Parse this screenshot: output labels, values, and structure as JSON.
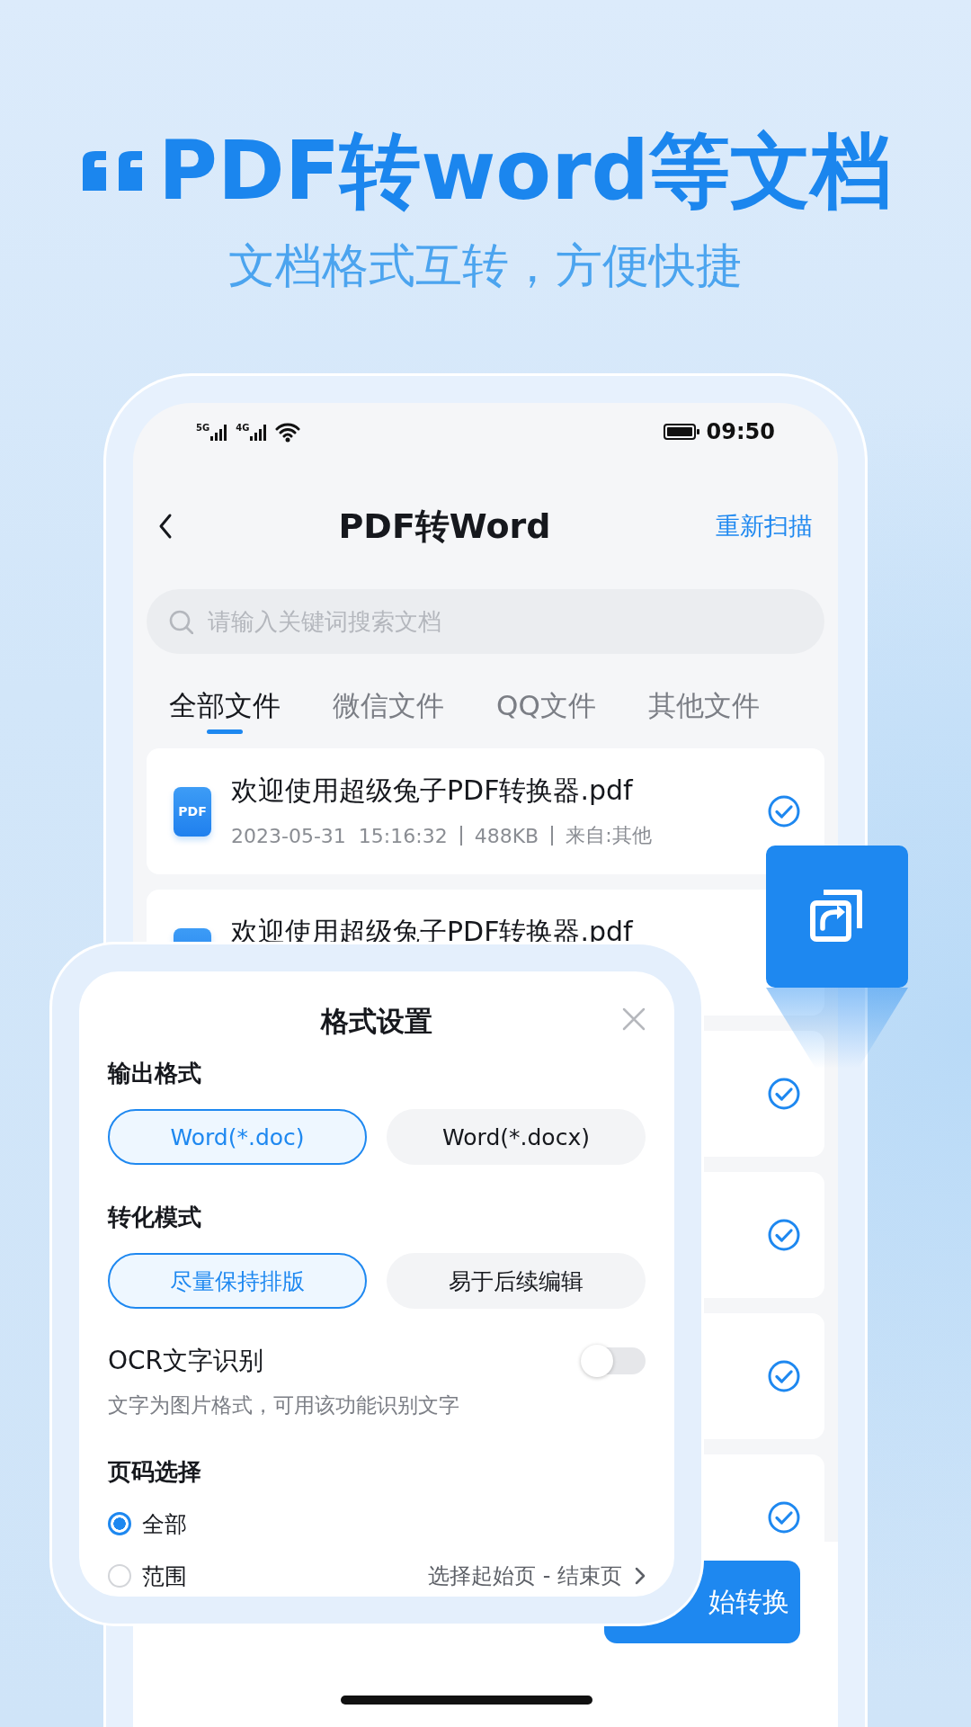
{
  "headline": {
    "title": "PDF转word等文档",
    "subtitle": "文档格式互转，方便快捷"
  },
  "status_bar": {
    "networks": [
      "5G",
      "4G"
    ],
    "time": "09:50"
  },
  "app_bar": {
    "title": "PDF转Word",
    "action": "重新扫描"
  },
  "search": {
    "placeholder": "请输入关键词搜索文档"
  },
  "tabs": [
    {
      "label": "全部文件",
      "selected": true
    },
    {
      "label": "微信文件",
      "selected": false
    },
    {
      "label": "QQ文件",
      "selected": false
    },
    {
      "label": "其他文件",
      "selected": false
    }
  ],
  "files": [
    {
      "name": "欢迎使用超级兔子PDF转换器.pdf",
      "icon_text": "PDF",
      "meta": [
        "2023-05-31  15:16:32",
        "488KB",
        "来自:其他"
      ],
      "checked": true
    },
    {
      "name": "欢迎使用超级兔子PDF转换器.pdf"
    },
    {
      "checked": true
    },
    {
      "checked": true
    },
    {
      "checked": true
    },
    {
      "checked": true
    }
  ],
  "start_button": {
    "label": "始转换"
  },
  "dialog": {
    "title": "格式设置",
    "sections": [
      {
        "kind": "choice",
        "label": "输出格式",
        "options": [
          {
            "label": "Word(*.doc)",
            "selected": true
          },
          {
            "label": "Word(*.docx)",
            "selected": false
          }
        ]
      },
      {
        "kind": "choice",
        "label": "转化模式",
        "options": [
          {
            "label": "尽量保持排版",
            "selected": true
          },
          {
            "label": "易于后续编辑",
            "selected": false
          }
        ]
      },
      {
        "kind": "toggle",
        "label": "OCR文字识别",
        "on": false,
        "hint": "文字为图片格式，可用该功能识别文字"
      },
      {
        "kind": "radio",
        "label": "页码选择",
        "options": [
          {
            "label": "全部",
            "selected": true
          },
          {
            "label": "范围",
            "selected": false,
            "detail": "选择起始页 - 结束页"
          }
        ]
      }
    ]
  }
}
